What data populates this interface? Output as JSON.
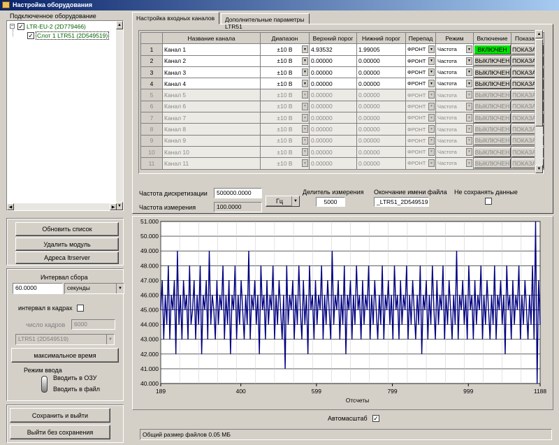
{
  "window": {
    "title": "Настройка оборудования"
  },
  "left": {
    "tree_header": "Подключенное оборудование",
    "tree": [
      {
        "label": "LTR-EU-2 (2D779466)",
        "checked": true
      },
      {
        "label": "Слот 1 LTR51 (2D549519)",
        "checked": true
      }
    ],
    "buttons": {
      "refresh": "Обновить список",
      "remove": "Удалить модуль",
      "address": "Адреса ltrserver"
    },
    "interval": {
      "label": "Интервал сбора",
      "value": "60.0000",
      "unit": "секунды",
      "frames_label": "интервал в кадрах",
      "frames_checked": false,
      "frames_count_label": "число кадров",
      "frames_count": "6000",
      "module_select": "LTR51 (2D549519)",
      "max_time": "максимальное время"
    },
    "input_mode": {
      "label": "Режим ввода",
      "opt_ram": "Вводить в ОЗУ",
      "opt_file": "Вводить в файл",
      "selected": "file"
    },
    "save_exit": "Сохранить и выйти",
    "exit_nosave": "Выйти без сохранения"
  },
  "tabs": [
    "Настройка входных каналов",
    "Дополнительные параметры LTR51"
  ],
  "active_tab": 0,
  "table": {
    "headers": [
      "",
      "Название канала",
      "Диапазон",
      "Верхний порог",
      "Нижний порог",
      "Перепад",
      "Режим",
      "Включение",
      "Показать"
    ],
    "rows": [
      {
        "n": "1",
        "name": "Канал 1",
        "range": "±10 В",
        "hi": "4.93532",
        "lo": "1.99005",
        "edge": "ФРОНТ",
        "mode": "Частота",
        "enable": "ВКЛЮЧЕН",
        "show": "ПОКАЗАТЬ",
        "active": true
      },
      {
        "n": "2",
        "name": "Канал 2",
        "range": "±10 В",
        "hi": "0.00000",
        "lo": "0.00000",
        "edge": "ФРОНТ",
        "mode": "Частота",
        "enable": "ВЫКЛЮЧЕН",
        "show": "ПОКАЗАТЬ",
        "active": false
      },
      {
        "n": "3",
        "name": "Канал 3",
        "range": "±10 В",
        "hi": "0.00000",
        "lo": "0.00000",
        "edge": "ФРОНТ",
        "mode": "Частота",
        "enable": "ВЫКЛЮЧЕН",
        "show": "ПОКАЗАТЬ",
        "active": false
      },
      {
        "n": "4",
        "name": "Канал 4",
        "range": "±10 В",
        "hi": "0.00000",
        "lo": "0.00000",
        "edge": "ФРОНТ",
        "mode": "Частота",
        "enable": "ВЫКЛЮЧЕН",
        "show": "ПОКАЗАТЬ",
        "active": false
      },
      {
        "n": "5",
        "name": "Канал 5",
        "range": "±10 В",
        "hi": "0.00000",
        "lo": "0.00000",
        "edge": "ФРОНТ",
        "mode": "Частота",
        "enable": "ВЫКЛЮЧЕН",
        "show": "ПОКАЗАТЬ",
        "active": false
      },
      {
        "n": "6",
        "name": "Канал 6",
        "range": "±10 В",
        "hi": "0.00000",
        "lo": "0.00000",
        "edge": "ФРОНТ",
        "mode": "Частота",
        "enable": "ВЫКЛЮЧЕН",
        "show": "ПОКАЗАТЬ",
        "active": false
      },
      {
        "n": "7",
        "name": "Канал 7",
        "range": "±10 В",
        "hi": "0.00000",
        "lo": "0.00000",
        "edge": "ФРОНТ",
        "mode": "Частота",
        "enable": "ВЫКЛЮЧЕН",
        "show": "ПОКАЗАТЬ",
        "active": false
      },
      {
        "n": "8",
        "name": "Канал 8",
        "range": "±10 В",
        "hi": "0.00000",
        "lo": "0.00000",
        "edge": "ФРОНТ",
        "mode": "Частота",
        "enable": "ВЫКЛЮЧЕН",
        "show": "ПОКАЗАТЬ",
        "active": false
      },
      {
        "n": "9",
        "name": "Канал 9",
        "range": "±10 В",
        "hi": "0.00000",
        "lo": "0.00000",
        "edge": "ФРОНТ",
        "mode": "Частота",
        "enable": "ВЫКЛЮЧЕН",
        "show": "ПОКАЗАТЬ",
        "active": false
      },
      {
        "n": "10",
        "name": "Канал 10",
        "range": "±10 В",
        "hi": "0.00000",
        "lo": "0.00000",
        "edge": "ФРОНТ",
        "mode": "Частота",
        "enable": "ВЫКЛЮЧЕН",
        "show": "ПОКАЗАТЬ",
        "active": false
      },
      {
        "n": "11",
        "name": "Канал 11",
        "range": "±10 В",
        "hi": "0.00000",
        "lo": "0.00000",
        "edge": "ФРОНТ",
        "mode": "Частота",
        "enable": "ВЫКЛЮЧЕН",
        "show": "ПОКАЗАТЬ",
        "active": false
      }
    ]
  },
  "params": {
    "sample_rate_label": "Частота дискретизации",
    "sample_rate": "500000.0000",
    "meas_rate_label": "Частота измерения",
    "meas_rate": "100.0000",
    "unit": "Гц",
    "divider_label": "Делитель измерения",
    "divider": "5000",
    "file_suffix_label": "Окончание имени файла",
    "file_suffix": "_LTR51_2D549519",
    "no_save_label": "Не сохранять данные",
    "no_save_checked": false
  },
  "chart_data": {
    "type": "line",
    "xlabel": "Отсчеты",
    "ylabel": "",
    "xlim": [
      189,
      1188
    ],
    "ylim": [
      40.0,
      51.0
    ],
    "x_ticks": [
      "189",
      "400",
      "599",
      "799",
      "999",
      "1188"
    ],
    "y_ticks": [
      "51.000",
      "50.000",
      "49.000",
      "48.000",
      "47.000",
      "46.000",
      "45.000",
      "44.000",
      "43.000",
      "42.000",
      "41.000",
      "40.000"
    ],
    "series": [
      {
        "values": [
          45.0,
          47.0,
          43.0,
          46.0,
          44.0,
          48.0,
          43.0,
          46.0,
          45.0,
          47.0,
          42.0,
          49.0,
          44.0,
          46.0,
          43.0,
          47.0,
          45.0,
          46.0,
          43.0,
          48.0,
          44.0,
          45.0,
          47.0,
          43.0,
          46.0,
          44.0,
          48.0,
          42.0,
          46.0,
          45.0,
          47.0,
          43.0,
          49.0,
          44.0,
          46.0,
          45.0,
          43.0,
          47.0,
          44.0,
          46.0,
          45.0,
          48.0,
          43.0,
          46.0,
          44.0,
          47.0,
          42.0,
          46.0,
          45.0,
          48.0,
          43.0,
          46.0,
          44.0,
          47.0,
          45.0,
          43.0,
          46.0,
          44.0,
          49.0,
          43.0,
          46.0,
          45.0,
          47.0,
          44.0,
          46.0,
          42.0,
          48.0,
          45.0,
          46.0,
          43.0,
          47.0,
          44.0,
          46.0,
          45.0,
          48.0,
          43.0,
          46.0,
          44.0,
          47.0,
          45.0,
          43.0,
          46.0,
          41.0,
          48.0,
          44.0,
          46.0,
          45.0,
          47.0,
          43.0,
          46.0,
          44.0,
          48.0,
          45.0,
          43.0,
          47.0,
          44.0,
          46.0,
          42.0,
          48.0,
          45.0,
          46.0,
          43.0,
          47.0,
          44.0,
          46.0,
          45.0,
          48.0,
          43.0,
          46.0,
          44.0,
          47.0,
          45.0,
          43.0,
          49.0,
          44.0,
          46.0,
          45.0,
          47.0,
          43.0,
          46.0,
          44.0,
          48.0,
          42.0,
          46.0,
          45.0,
          47.0,
          43.0,
          46.0,
          44.0,
          48.0,
          45.0,
          46.0,
          43.0,
          47.0,
          44.0,
          46.0,
          45.0,
          48.0,
          43.0,
          46.0,
          44.0,
          47.0,
          45.0,
          43.0,
          46.0,
          44.0,
          48.0,
          43.0,
          46.0,
          45.0,
          47.0,
          44.0,
          46.0,
          43.0,
          48.0,
          45.0,
          46.0,
          43.0,
          47.0,
          44.0,
          46.0,
          45.0,
          48.0,
          43.0,
          46.0,
          44.0,
          47.0,
          45.0,
          43.0,
          46.0,
          44.0,
          48.0,
          42.0,
          46.0,
          45.0,
          47.0,
          43.0,
          46.0,
          44.0,
          48.0,
          45.0,
          43.0,
          47.0,
          44.0,
          46.0,
          45.0,
          48.0,
          43.0,
          46.0,
          44.0,
          47.0,
          45.0,
          43.0,
          46.0,
          44.0,
          49.0,
          43.0,
          46.0,
          45.0,
          47.0,
          44.0,
          46.0,
          43.0,
          48.0,
          45.0,
          46.0,
          43.0,
          47.0,
          44.0,
          46.0,
          45.0,
          48.0,
          43.0,
          46.0,
          44.0,
          47.0,
          45.0,
          43.0,
          46.0,
          44.0,
          48.0,
          43.0,
          46.0,
          45.0,
          47.0,
          44.0,
          46.0,
          42.0,
          48.0,
          45.0,
          46.0,
          43.0,
          47.0,
          44.0,
          46.0,
          45.0,
          48.0,
          43.0,
          46.0,
          44.0,
          47.0,
          45.0,
          43.0,
          46.0,
          44.0,
          48.0,
          43.0,
          51.0,
          40.0,
          47.0,
          44.0
        ]
      }
    ],
    "grid": true,
    "line_color": "#000080"
  },
  "autoscale": {
    "label": "Автомасштаб",
    "checked": true
  },
  "status": "Общий размер файлов 0.05 МБ",
  "colors": {
    "enabled": "#00e000",
    "line": "#000080",
    "title_start": "#0a246a",
    "title_end": "#a6caf0"
  }
}
